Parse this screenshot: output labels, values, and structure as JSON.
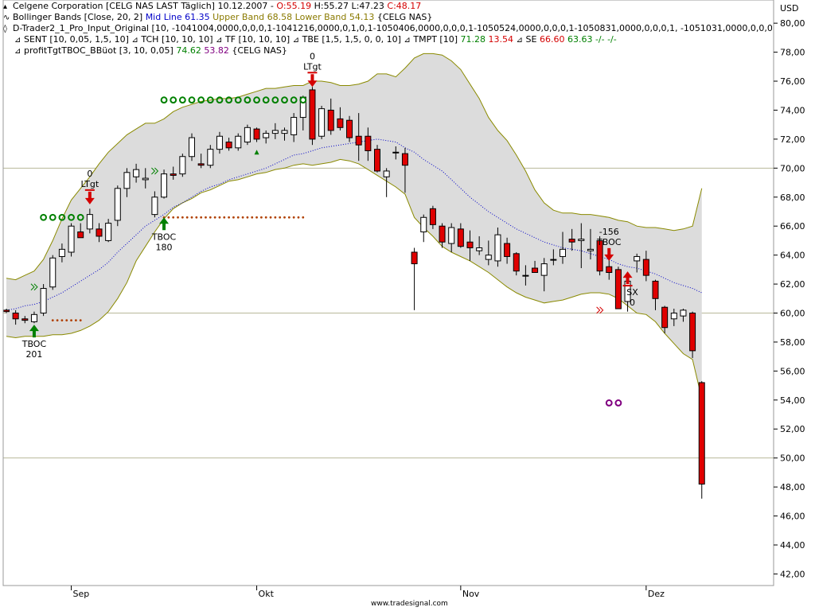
{
  "header": {
    "line1": {
      "name": "Celgene Corporation [CELG NAS LAST Täglich] 10.12.2007 - ",
      "open_label": "O:",
      "open": "55.19",
      "high_label": " H:",
      "high": "55.27",
      "low_label": " L:",
      "low": "47.23",
      "close_label": " C:",
      "close": "48.17"
    },
    "line2": {
      "name": "Bollinger Bands [Close, 20, 2] ",
      "mid": "Mid Line 61.35",
      "upper": " Upper Band 68.58",
      "lower": " Lower Band 54.13",
      "sym": " {CELG NAS}"
    },
    "line3": "D-Trader2_1_Pro_Input_Original [10, -1041004,0000,0,0,0,1-1041216,0000,0,1,0,1-1050406,0000,0,0,0,1-1050524,0000,0,0,0,1-1050831,0000,0,0,0,1, -1051031,0000,0,0,0,1-1051229,000...",
    "line4": {
      "sent": "SENT [10, 0,05, 1,5, 10]",
      "tch": "TCH [10, 10, 10]",
      "tf": "TF [10, 10, 10]",
      "tbe": "TBE [1,5, 1,5, 0, 0, 10]",
      "tmpt": "TMPT [10] ",
      "tmpt_v1": "71.28",
      "tmpt_v2": " 13.54",
      "se": "SE ",
      "se_v1": "66.60",
      "se_v2": " 63.63",
      "se_v3": " -/- -/-"
    },
    "line5": {
      "name": "profitTgtTBOC_BBüot [3, 10, 0,05] ",
      "v1": "74.62",
      "v2": " 53.82",
      "sym": " {CELG NAS}"
    }
  },
  "axis_unit": "USD",
  "footer": "www.tradesignal.com",
  "colors": {
    "bull": "#ffffff",
    "bear": "#e00000",
    "band_fill": "#dcdcdc",
    "band_line": "#8a8a00",
    "mid_line": "#0000c8",
    "green_marker": "#008000",
    "red_marker": "#d40000",
    "stop_dots": "#b04000",
    "purple_marker": "#800080"
  },
  "chart_data": {
    "type": "candlestick",
    "title": "Celgene Corporation [CELG NAS LAST Täglich]",
    "ylabel": "USD",
    "ylim": [
      41.2,
      81.6
    ],
    "y_ticks": [
      42,
      44,
      46,
      48,
      50,
      52,
      54,
      56,
      58,
      60,
      62,
      64,
      66,
      68,
      70,
      72,
      74,
      76,
      78,
      80
    ],
    "y_tick_labels": [
      "42,00",
      "44,00",
      "46,00",
      "48,00",
      "50,00",
      "52,00",
      "54,00",
      "56,00",
      "58,00",
      "60,00",
      "62,00",
      "64,00",
      "66,00",
      "68,00",
      "70,00",
      "72,00",
      "74,00",
      "76,00",
      "78,00",
      "80,00"
    ],
    "ref_lines": [
      50,
      60,
      70
    ],
    "x_labels": [
      {
        "label": "Sep",
        "index": 7
      },
      {
        "label": "Okt",
        "index": 27
      },
      {
        "label": "Nov",
        "index": 49
      },
      {
        "label": "Dez",
        "index": 69
      }
    ],
    "candles": [
      {
        "o": 60.2,
        "h": 60.3,
        "l": 60.0,
        "c": 60.1
      },
      {
        "o": 60.0,
        "h": 60.2,
        "l": 59.2,
        "c": 59.6
      },
      {
        "o": 59.6,
        "h": 59.8,
        "l": 59.3,
        "c": 59.5
      },
      {
        "o": 59.4,
        "h": 60.1,
        "l": 59.3,
        "c": 59.9
      },
      {
        "o": 60.0,
        "h": 62.0,
        "l": 59.8,
        "c": 61.7
      },
      {
        "o": 61.8,
        "h": 64.0,
        "l": 61.6,
        "c": 63.8
      },
      {
        "o": 63.9,
        "h": 64.8,
        "l": 63.5,
        "c": 64.4
      },
      {
        "o": 64.2,
        "h": 66.2,
        "l": 63.9,
        "c": 66.0
      },
      {
        "o": 65.6,
        "h": 66.2,
        "l": 65.2,
        "c": 65.2
      },
      {
        "o": 65.8,
        "h": 67.2,
        "l": 65.5,
        "c": 66.8
      },
      {
        "o": 65.8,
        "h": 66.2,
        "l": 64.9,
        "c": 65.3
      },
      {
        "o": 65.0,
        "h": 66.5,
        "l": 64.9,
        "c": 66.2
      },
      {
        "o": 66.4,
        "h": 68.8,
        "l": 66.0,
        "c": 68.6
      },
      {
        "o": 68.6,
        "h": 70.0,
        "l": 68.0,
        "c": 69.7
      },
      {
        "o": 69.4,
        "h": 70.3,
        "l": 69.0,
        "c": 69.9
      },
      {
        "o": 69.2,
        "h": 70.0,
        "l": 68.6,
        "c": 69.3
      },
      {
        "o": 66.8,
        "h": 68.4,
        "l": 66.6,
        "c": 68.0
      },
      {
        "o": 68.0,
        "h": 69.9,
        "l": 67.9,
        "c": 69.6
      },
      {
        "o": 69.6,
        "h": 70.1,
        "l": 69.2,
        "c": 69.5
      },
      {
        "o": 69.6,
        "h": 71.0,
        "l": 69.4,
        "c": 70.8
      },
      {
        "o": 70.8,
        "h": 72.4,
        "l": 70.5,
        "c": 72.1
      },
      {
        "o": 70.3,
        "h": 71.0,
        "l": 70.0,
        "c": 70.2
      },
      {
        "o": 70.2,
        "h": 71.6,
        "l": 70.0,
        "c": 71.3
      },
      {
        "o": 71.3,
        "h": 72.5,
        "l": 71.0,
        "c": 72.2
      },
      {
        "o": 71.8,
        "h": 72.1,
        "l": 71.2,
        "c": 71.4
      },
      {
        "o": 71.4,
        "h": 72.4,
        "l": 71.2,
        "c": 72.2
      },
      {
        "o": 71.8,
        "h": 73.0,
        "l": 71.6,
        "c": 72.8
      },
      {
        "o": 72.7,
        "h": 72.8,
        "l": 71.8,
        "c": 72.0
      },
      {
        "o": 72.1,
        "h": 72.6,
        "l": 71.7,
        "c": 72.4
      },
      {
        "o": 72.4,
        "h": 73.1,
        "l": 72.0,
        "c": 72.6
      },
      {
        "o": 72.4,
        "h": 72.8,
        "l": 71.9,
        "c": 72.6
      },
      {
        "o": 72.3,
        "h": 73.8,
        "l": 71.8,
        "c": 73.5
      },
      {
        "o": 73.5,
        "h": 75.0,
        "l": 72.6,
        "c": 74.9
      },
      {
        "o": 75.4,
        "h": 75.6,
        "l": 71.6,
        "c": 72.0
      },
      {
        "o": 72.2,
        "h": 74.3,
        "l": 72.0,
        "c": 74.1
      },
      {
        "o": 74.0,
        "h": 74.8,
        "l": 72.3,
        "c": 72.6
      },
      {
        "o": 73.4,
        "h": 74.2,
        "l": 72.6,
        "c": 72.8
      },
      {
        "o": 73.3,
        "h": 73.6,
        "l": 71.8,
        "c": 72.1
      },
      {
        "o": 72.2,
        "h": 73.8,
        "l": 70.5,
        "c": 71.6
      },
      {
        "o": 72.2,
        "h": 72.8,
        "l": 70.5,
        "c": 71.2
      },
      {
        "o": 71.3,
        "h": 71.6,
        "l": 69.7,
        "c": 69.8
      },
      {
        "o": 69.4,
        "h": 70.0,
        "l": 68.0,
        "c": 69.8
      },
      {
        "o": 71.1,
        "h": 71.5,
        "l": 70.6,
        "c": 71.1
      },
      {
        "o": 71.0,
        "h": 71.4,
        "l": 68.3,
        "c": 70.2
      },
      {
        "o": 64.2,
        "h": 64.5,
        "l": 60.2,
        "c": 63.4
      },
      {
        "o": 65.6,
        "h": 66.8,
        "l": 64.9,
        "c": 66.6
      },
      {
        "o": 67.2,
        "h": 67.4,
        "l": 65.8,
        "c": 66.1
      },
      {
        "o": 66.0,
        "h": 66.2,
        "l": 64.5,
        "c": 64.9
      },
      {
        "o": 64.8,
        "h": 66.2,
        "l": 64.2,
        "c": 65.9
      },
      {
        "o": 65.8,
        "h": 66.2,
        "l": 64.5,
        "c": 64.6
      },
      {
        "o": 64.9,
        "h": 65.7,
        "l": 63.6,
        "c": 64.5
      },
      {
        "o": 64.3,
        "h": 65.3,
        "l": 64.0,
        "c": 64.5
      },
      {
        "o": 63.7,
        "h": 65.0,
        "l": 63.3,
        "c": 64.0
      },
      {
        "o": 63.6,
        "h": 65.9,
        "l": 63.2,
        "c": 65.4
      },
      {
        "o": 64.8,
        "h": 65.2,
        "l": 63.4,
        "c": 63.9
      },
      {
        "o": 64.1,
        "h": 64.2,
        "l": 62.6,
        "c": 62.9
      },
      {
        "o": 62.6,
        "h": 63.3,
        "l": 61.9,
        "c": 62.6
      },
      {
        "o": 63.1,
        "h": 63.6,
        "l": 62.8,
        "c": 62.8
      },
      {
        "o": 62.6,
        "h": 63.8,
        "l": 61.5,
        "c": 63.4
      },
      {
        "o": 63.7,
        "h": 64.4,
        "l": 63.3,
        "c": 63.7
      },
      {
        "o": 63.9,
        "h": 65.6,
        "l": 63.4,
        "c": 64.4
      },
      {
        "o": 65.1,
        "h": 65.8,
        "l": 64.3,
        "c": 64.9
      },
      {
        "o": 65.0,
        "h": 66.2,
        "l": 63.1,
        "c": 65.1
      },
      {
        "o": 64.3,
        "h": 65.8,
        "l": 63.7,
        "c": 64.4
      },
      {
        "o": 65.0,
        "h": 65.3,
        "l": 62.6,
        "c": 62.9
      },
      {
        "o": 63.2,
        "h": 64.1,
        "l": 62.3,
        "c": 62.8
      },
      {
        "o": 63.0,
        "h": 63.2,
        "l": 60.3,
        "c": 60.3
      },
      {
        "o": 60.8,
        "h": 62.3,
        "l": 60.1,
        "c": 62.2
      },
      {
        "o": 63.6,
        "h": 64.1,
        "l": 62.8,
        "c": 63.9
      },
      {
        "o": 63.7,
        "h": 64.3,
        "l": 62.2,
        "c": 62.6
      },
      {
        "o": 62.2,
        "h": 62.3,
        "l": 60.2,
        "c": 61.0
      },
      {
        "o": 60.4,
        "h": 60.5,
        "l": 58.6,
        "c": 59.0
      },
      {
        "o": 59.6,
        "h": 60.3,
        "l": 59.1,
        "c": 60.0
      },
      {
        "o": 59.8,
        "h": 60.3,
        "l": 59.4,
        "c": 60.2
      },
      {
        "o": 60.0,
        "h": 60.1,
        "l": 56.9,
        "c": 57.4
      },
      {
        "o": 55.2,
        "h": 55.3,
        "l": 47.2,
        "c": 48.2
      }
    ],
    "bollinger": {
      "upper": [
        62.4,
        62.3,
        62.6,
        62.9,
        63.7,
        65.0,
        66.5,
        67.8,
        68.6,
        69.4,
        70.3,
        71.1,
        71.7,
        72.3,
        72.7,
        73.1,
        73.1,
        73.4,
        73.9,
        74.2,
        74.4,
        74.6,
        74.7,
        74.8,
        74.8,
        74.9,
        75.1,
        75.3,
        75.5,
        75.5,
        75.6,
        75.7,
        75.7,
        76.0,
        76.0,
        75.9,
        75.7,
        75.7,
        75.8,
        76.0,
        76.5,
        76.5,
        76.3,
        76.9,
        77.6,
        77.9,
        77.9,
        77.8,
        77.4,
        76.8,
        75.8,
        74.8,
        73.5,
        72.6,
        71.9,
        70.9,
        69.8,
        68.5,
        67.6,
        67.1,
        66.9,
        66.9,
        66.8,
        66.8,
        66.7,
        66.6,
        66.4,
        66.3,
        66.0,
        65.9,
        65.9,
        65.8,
        65.7,
        65.8,
        66.0,
        68.6
      ],
      "mid": [
        60.2,
        60.3,
        60.5,
        60.6,
        60.8,
        61.1,
        61.4,
        61.8,
        62.2,
        62.6,
        63.0,
        63.5,
        64.2,
        64.8,
        65.4,
        66.0,
        66.4,
        66.8,
        67.3,
        67.6,
        68.0,
        68.4,
        68.7,
        68.9,
        69.2,
        69.4,
        69.6,
        69.8,
        70.0,
        70.3,
        70.6,
        70.9,
        71.0,
        71.2,
        71.4,
        71.5,
        71.6,
        71.7,
        71.8,
        71.9,
        72.0,
        71.9,
        71.8,
        71.4,
        71.1,
        70.6,
        70.2,
        69.8,
        69.2,
        68.6,
        68.0,
        67.5,
        67.0,
        66.6,
        66.2,
        65.8,
        65.5,
        65.2,
        64.9,
        64.7,
        64.5,
        64.4,
        64.3,
        64.1,
        63.9,
        63.7,
        63.4,
        63.2,
        63.1,
        62.9,
        62.7,
        62.4,
        62.1,
        61.9,
        61.7,
        61.4
      ],
      "lower": [
        58.4,
        58.3,
        58.4,
        58.4,
        58.4,
        58.5,
        58.5,
        58.6,
        58.8,
        59.1,
        59.5,
        60.1,
        61.0,
        62.1,
        63.6,
        64.6,
        65.6,
        66.5,
        67.2,
        67.6,
        67.9,
        68.3,
        68.5,
        68.8,
        69.1,
        69.2,
        69.4,
        69.6,
        69.7,
        69.9,
        70.0,
        70.2,
        70.3,
        70.2,
        70.3,
        70.4,
        70.6,
        70.5,
        70.3,
        69.9,
        69.5,
        69.1,
        68.7,
        68.2,
        66.6,
        65.9,
        65.3,
        64.6,
        64.2,
        63.9,
        63.6,
        63.2,
        62.8,
        62.3,
        61.8,
        61.4,
        61.1,
        60.9,
        60.7,
        60.8,
        60.9,
        61.1,
        61.3,
        61.4,
        61.4,
        61.3,
        61.0,
        60.5,
        60.0,
        59.9,
        59.4,
        58.6,
        57.9,
        57.2,
        56.8,
        54.1
      ]
    },
    "annotations": {
      "tboc_signals": [
        {
          "index": 3,
          "value": 59.2,
          "number": "201",
          "label": "TBOC"
        },
        {
          "index": 17,
          "value": 66.6,
          "number": "180",
          "label": "TBOC"
        }
      ],
      "ltgt_signals": [
        {
          "index": 9,
          "value": 67.5,
          "number": "0",
          "label": "LTgt"
        },
        {
          "index": 33,
          "value": 75.6,
          "number": "0",
          "label": "LTgt"
        }
      ],
      "short_entry": {
        "index": 65,
        "value": 63.6,
        "number": "-156",
        "label": "TBOC"
      },
      "sx_exit": {
        "index": 67,
        "value": 62.0,
        "number": "0",
        "label": "SX"
      },
      "green_circles": [
        {
          "from": 4,
          "to": 8,
          "value": 66.6
        },
        {
          "from": 17,
          "to": 32,
          "value": 74.7
        }
      ],
      "purple_circles": [
        {
          "from": 65,
          "to": 66,
          "value": 53.8
        }
      ],
      "stop_dots": [
        {
          "from": 5,
          "to": 8,
          "value": 59.5
        },
        {
          "from": 17,
          "to": 32,
          "value": 66.6
        }
      ],
      "green_chevrons": [
        {
          "index": 3,
          "value": 61.8
        },
        {
          "index": 16,
          "value": 69.8
        }
      ],
      "red_chevrons": [
        {
          "index": 64,
          "value": 60.2
        }
      ],
      "green_triangles": [
        {
          "index": 27,
          "value": 71.1
        }
      ]
    }
  }
}
